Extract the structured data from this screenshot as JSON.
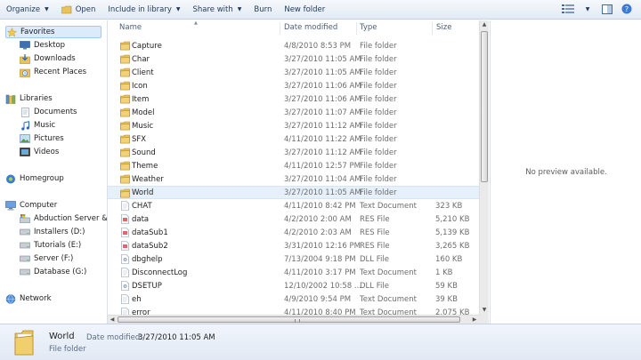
{
  "toolbar": {
    "organize": "Organize",
    "open": "Open",
    "include": "Include in library",
    "share": "Share with",
    "burn": "Burn",
    "new_folder": "New folder"
  },
  "nav": {
    "favorites": "Favorites",
    "desktop": "Desktop",
    "downloads": "Downloads",
    "recent": "Recent Places",
    "libraries": "Libraries",
    "documents": "Documents",
    "music": "Music",
    "pictures": "Pictures",
    "videos": "Videos",
    "homegroup": "Homegroup",
    "computer": "Computer",
    "abduction": "Abduction Server & D",
    "installers": "Installers (D:)",
    "tutorials": "Tutorials (E:)",
    "server": "Server (F:)",
    "database": "Database (G:)",
    "network": "Network"
  },
  "columns": {
    "name": "Name",
    "date": "Date modified",
    "type": "Type",
    "size": "Size"
  },
  "files": [
    {
      "name": "Capture",
      "date": "4/8/2010 8:53 PM",
      "type": "File folder",
      "size": "",
      "icon": "folder-icon"
    },
    {
      "name": "Char",
      "date": "3/27/2010 11:05 AM",
      "type": "File folder",
      "size": "",
      "icon": "folder-icon"
    },
    {
      "name": "Client",
      "date": "3/27/2010 11:05 AM",
      "type": "File folder",
      "size": "",
      "icon": "folder-icon"
    },
    {
      "name": "Icon",
      "date": "3/27/2010 11:06 AM",
      "type": "File folder",
      "size": "",
      "icon": "folder-icon"
    },
    {
      "name": "Item",
      "date": "3/27/2010 11:06 AM",
      "type": "File folder",
      "size": "",
      "icon": "folder-icon"
    },
    {
      "name": "Model",
      "date": "3/27/2010 11:07 AM",
      "type": "File folder",
      "size": "",
      "icon": "folder-icon"
    },
    {
      "name": "Music",
      "date": "3/27/2010 11:12 AM",
      "type": "File folder",
      "size": "",
      "icon": "folder-icon"
    },
    {
      "name": "SFX",
      "date": "4/11/2010 11:22 AM",
      "type": "File folder",
      "size": "",
      "icon": "folder-icon"
    },
    {
      "name": "Sound",
      "date": "3/27/2010 11:12 AM",
      "type": "File folder",
      "size": "",
      "icon": "folder-icon"
    },
    {
      "name": "Theme",
      "date": "4/11/2010 12:57 PM",
      "type": "File folder",
      "size": "",
      "icon": "folder-icon"
    },
    {
      "name": "Weather",
      "date": "3/27/2010 11:04 AM",
      "type": "File folder",
      "size": "",
      "icon": "folder-icon"
    },
    {
      "name": "World",
      "date": "3/27/2010 11:05 AM",
      "type": "File folder",
      "size": "",
      "icon": "folder-icon"
    },
    {
      "name": "CHAT",
      "date": "4/11/2010 8:42 PM",
      "type": "Text Document",
      "size": "323 KB",
      "icon": "text-file-icon"
    },
    {
      "name": "data",
      "date": "4/2/2010 2:00 AM",
      "type": "RES File",
      "size": "5,210 KB",
      "icon": "res-file-icon"
    },
    {
      "name": "dataSub1",
      "date": "4/2/2010 2:03 AM",
      "type": "RES File",
      "size": "5,139 KB",
      "icon": "res-file-icon"
    },
    {
      "name": "dataSub2",
      "date": "3/31/2010 12:16 PM",
      "type": "RES File",
      "size": "3,265 KB",
      "icon": "res-file-icon"
    },
    {
      "name": "dbghelp",
      "date": "7/13/2004 9:18 PM",
      "type": "DLL File",
      "size": "160 KB",
      "icon": "dll-file-icon"
    },
    {
      "name": "DisconnectLog",
      "date": "4/11/2010 3:17 PM",
      "type": "Text Document",
      "size": "1 KB",
      "icon": "text-file-icon"
    },
    {
      "name": "DSETUP",
      "date": "12/10/2002 10:58 ...",
      "type": "DLL File",
      "size": "59 KB",
      "icon": "dll-file-icon"
    },
    {
      "name": "eh",
      "date": "4/9/2010 9:54 PM",
      "type": "Text Document",
      "size": "39 KB",
      "icon": "text-file-icon"
    },
    {
      "name": "error",
      "date": "4/11/2010 8:40 PM",
      "type": "Text Document",
      "size": "2,075 KB",
      "icon": "text-file-icon"
    }
  ],
  "preview": {
    "message": "No preview available."
  },
  "details": {
    "name": "World",
    "date_label": "Date modified:",
    "date_value": "3/27/2010 11:05 AM",
    "kind": "File folder"
  },
  "colors": {
    "toolbar_text": "#1e395b",
    "selection_bg": "#e6f0fa",
    "folder": "#e8c25a"
  }
}
